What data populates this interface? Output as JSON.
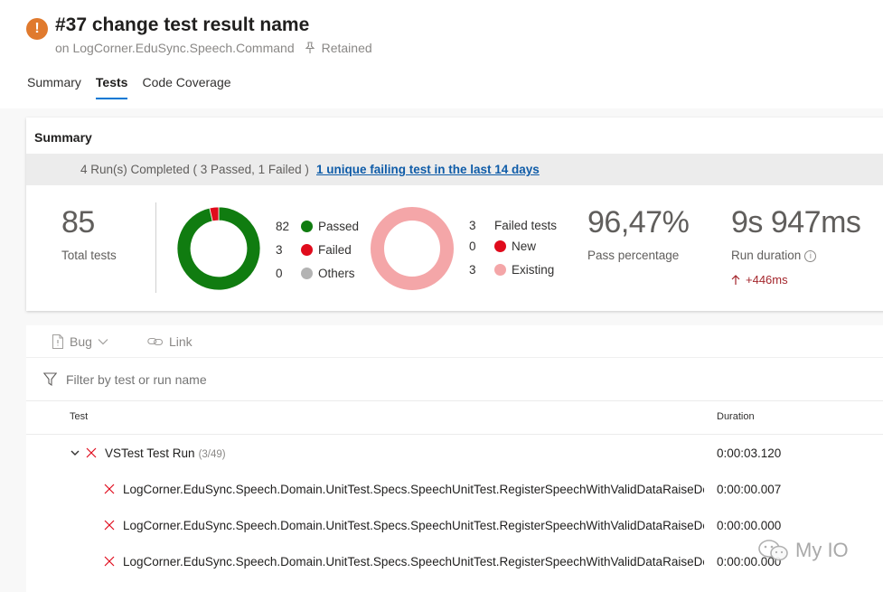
{
  "header": {
    "title": "#37 change test result name",
    "subtitle_prefix": "on LogCorner.EduSync.Speech.Command",
    "retained": "Retained"
  },
  "tabs": [
    {
      "label": "Summary"
    },
    {
      "label": "Tests"
    },
    {
      "label": "Code Coverage"
    }
  ],
  "summary": {
    "title": "Summary",
    "runs_text": "4 Run(s) Completed ( 3 Passed, 1 Failed )",
    "failing_link": "1 unique failing test in the last 14 days",
    "total_tests": "85",
    "total_label": "Total tests",
    "outcome": {
      "passed_count": "82",
      "passed_label": "Passed",
      "failed_count": "3",
      "failed_label": "Failed",
      "others_count": "0",
      "others_label": "Others",
      "passed_value": 82,
      "failed_value": 3,
      "others_value": 0
    },
    "failures": {
      "failed_tests_count": "3",
      "failed_tests_label": "Failed tests",
      "new_count": "0",
      "new_label": "New",
      "existing_count": "3",
      "existing_label": "Existing",
      "new_value": 0,
      "existing_value": 3
    },
    "pass_percentage": "96,47%",
    "pass_label": "Pass percentage",
    "run_duration": "9s 947ms",
    "duration_label": "Run duration",
    "duration_delta": "+446ms"
  },
  "colors": {
    "passed": "#107c10",
    "failed": "#e00b1c",
    "others": "#b3b3b3",
    "existing": "#f4a6a8",
    "accent": "#0078d4",
    "status_warning": "#e07a2e"
  },
  "toolbar": {
    "bug_label": "Bug",
    "link_label": "Link"
  },
  "filter": {
    "placeholder": "Filter by test or run name"
  },
  "table": {
    "col_test": "Test",
    "col_duration": "Duration",
    "run": {
      "name": "VSTest Test Run",
      "count": "(3/49)",
      "duration": "0:00:03.120"
    },
    "rows": [
      {
        "name": "LogCorner.EduSync.Speech.Domain.UnitTest.Specs.SpeechUnitTest.RegisterSpeechWithValidDataRaiseDo",
        "duration": "0:00:00.007"
      },
      {
        "name": "LogCorner.EduSync.Speech.Domain.UnitTest.Specs.SpeechUnitTest.RegisterSpeechWithValidDataRaiseDo",
        "duration": "0:00:00.000"
      },
      {
        "name": "LogCorner.EduSync.Speech.Domain.UnitTest.Specs.SpeechUnitTest.RegisterSpeechWithValidDataRaiseDo",
        "duration": "0:00:00.000"
      }
    ]
  },
  "watermark": {
    "text": "My IO"
  }
}
